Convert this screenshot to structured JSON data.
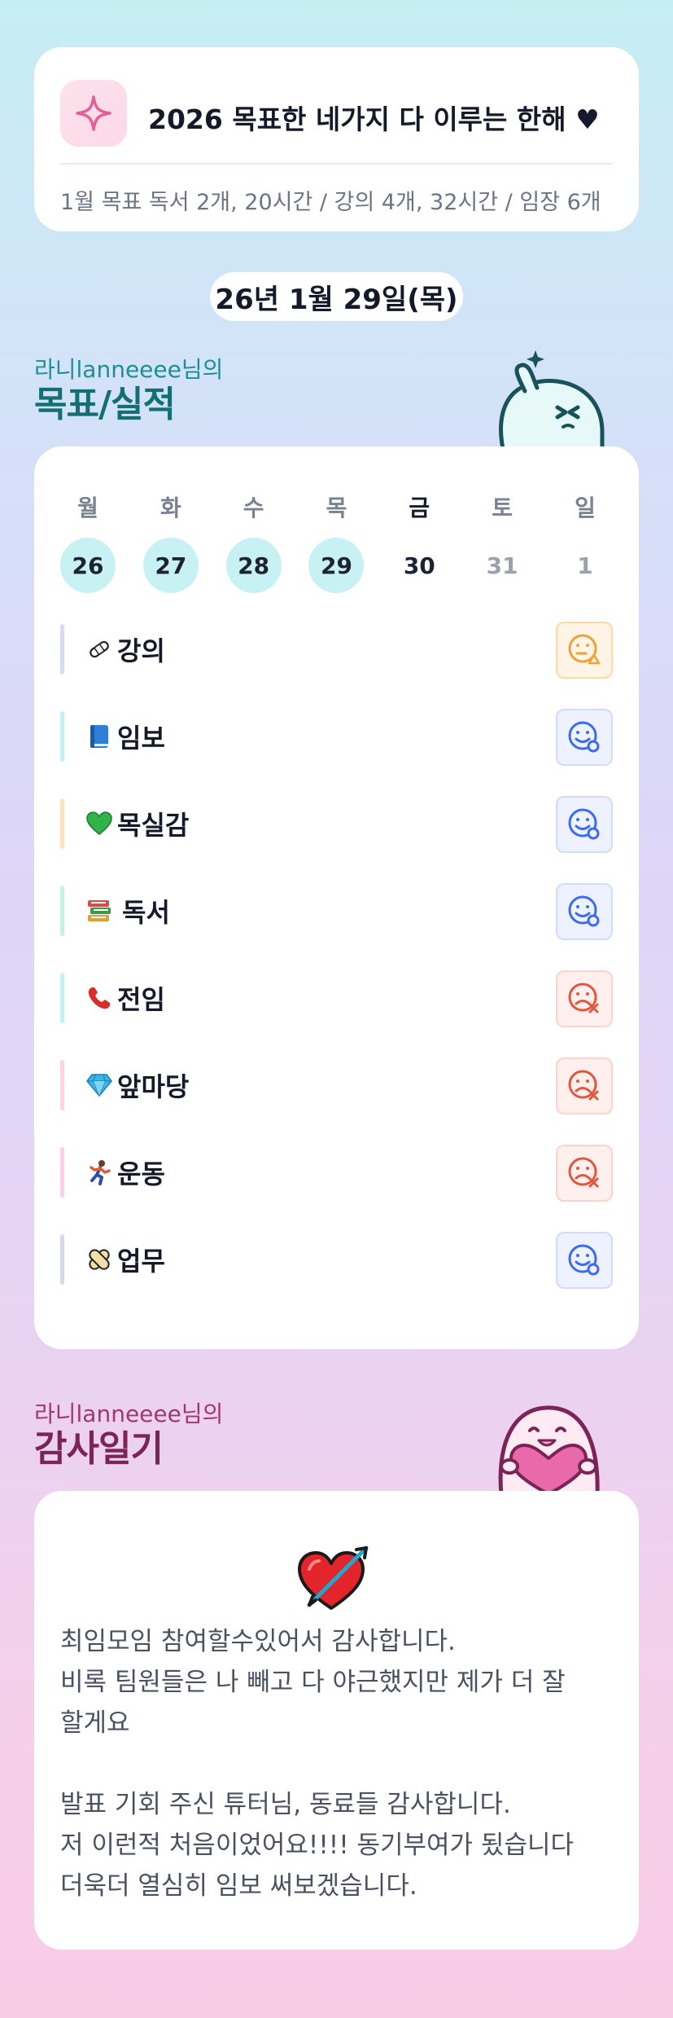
{
  "goal": {
    "title": "2026 목표한 네가지 다 이루는 한해 ♥",
    "subtitle": "1월 목표  독서 2개, 20시간 / 강의 4개, 32시간 / 임장 6개"
  },
  "date": "26년 1월 29일(목)",
  "section1": {
    "small": "라니lanneeee님의",
    "big": "목표/실적"
  },
  "week": {
    "days": [
      {
        "name": "월",
        "num": "26",
        "state": "done"
      },
      {
        "name": "화",
        "num": "27",
        "state": "done"
      },
      {
        "name": "수",
        "num": "28",
        "state": "done"
      },
      {
        "name": "목",
        "num": "29",
        "state": "done"
      },
      {
        "name": "금",
        "num": "30",
        "state": "today"
      },
      {
        "name": "토",
        "num": "31",
        "state": "future"
      },
      {
        "name": "일",
        "num": "1",
        "state": "future"
      }
    ]
  },
  "goals": [
    {
      "icon": "bandage-icon",
      "label": "강의",
      "status": "partial",
      "bar": "#d7dcf4"
    },
    {
      "icon": "book-icon",
      "label": "임보",
      "status": "done",
      "bar": "#c5f0f4"
    },
    {
      "icon": "green-heart-icon",
      "label": "목실감",
      "status": "done",
      "bar": "#fde2c2"
    },
    {
      "icon": "books-icon",
      "label": "독서",
      "status": "done",
      "bar": "#c9f1dd"
    },
    {
      "icon": "phone-icon",
      "label": "전임",
      "status": "fail",
      "bar": "#c5f0f4"
    },
    {
      "icon": "gem-icon",
      "label": "앞마당",
      "status": "fail",
      "bar": "#fcd6dc"
    },
    {
      "icon": "runner-icon",
      "label": "운동",
      "status": "fail",
      "bar": "#f9d2e8"
    },
    {
      "icon": "bandage-icon",
      "label": "업무",
      "status": "done",
      "bar": "#d5dbe6"
    }
  ],
  "section2": {
    "small": "라니lanneeee님의",
    "big": "감사일기"
  },
  "thanks": {
    "para1": [
      "최임모임 참여할수있어서 감사합니다.",
      "비록 팀원들은 나 빼고 다 야근했지만 제가 더 잘",
      "할게요"
    ],
    "para2": [
      "발표 기회 주신 튜터님, 동료들 감사합니다.",
      "저 이런적 처음이었어요!!!! 동기부여가 됬습니다",
      "더욱더 열심히 임보 써보겠습니다."
    ]
  },
  "colors": {
    "teal": "#1d8f94",
    "plum": "#7b2455",
    "done_day": "#c8f1f4",
    "blue_face": "#3b6cf0",
    "red_face": "#e4553f",
    "orange_face": "#f0a23a"
  }
}
